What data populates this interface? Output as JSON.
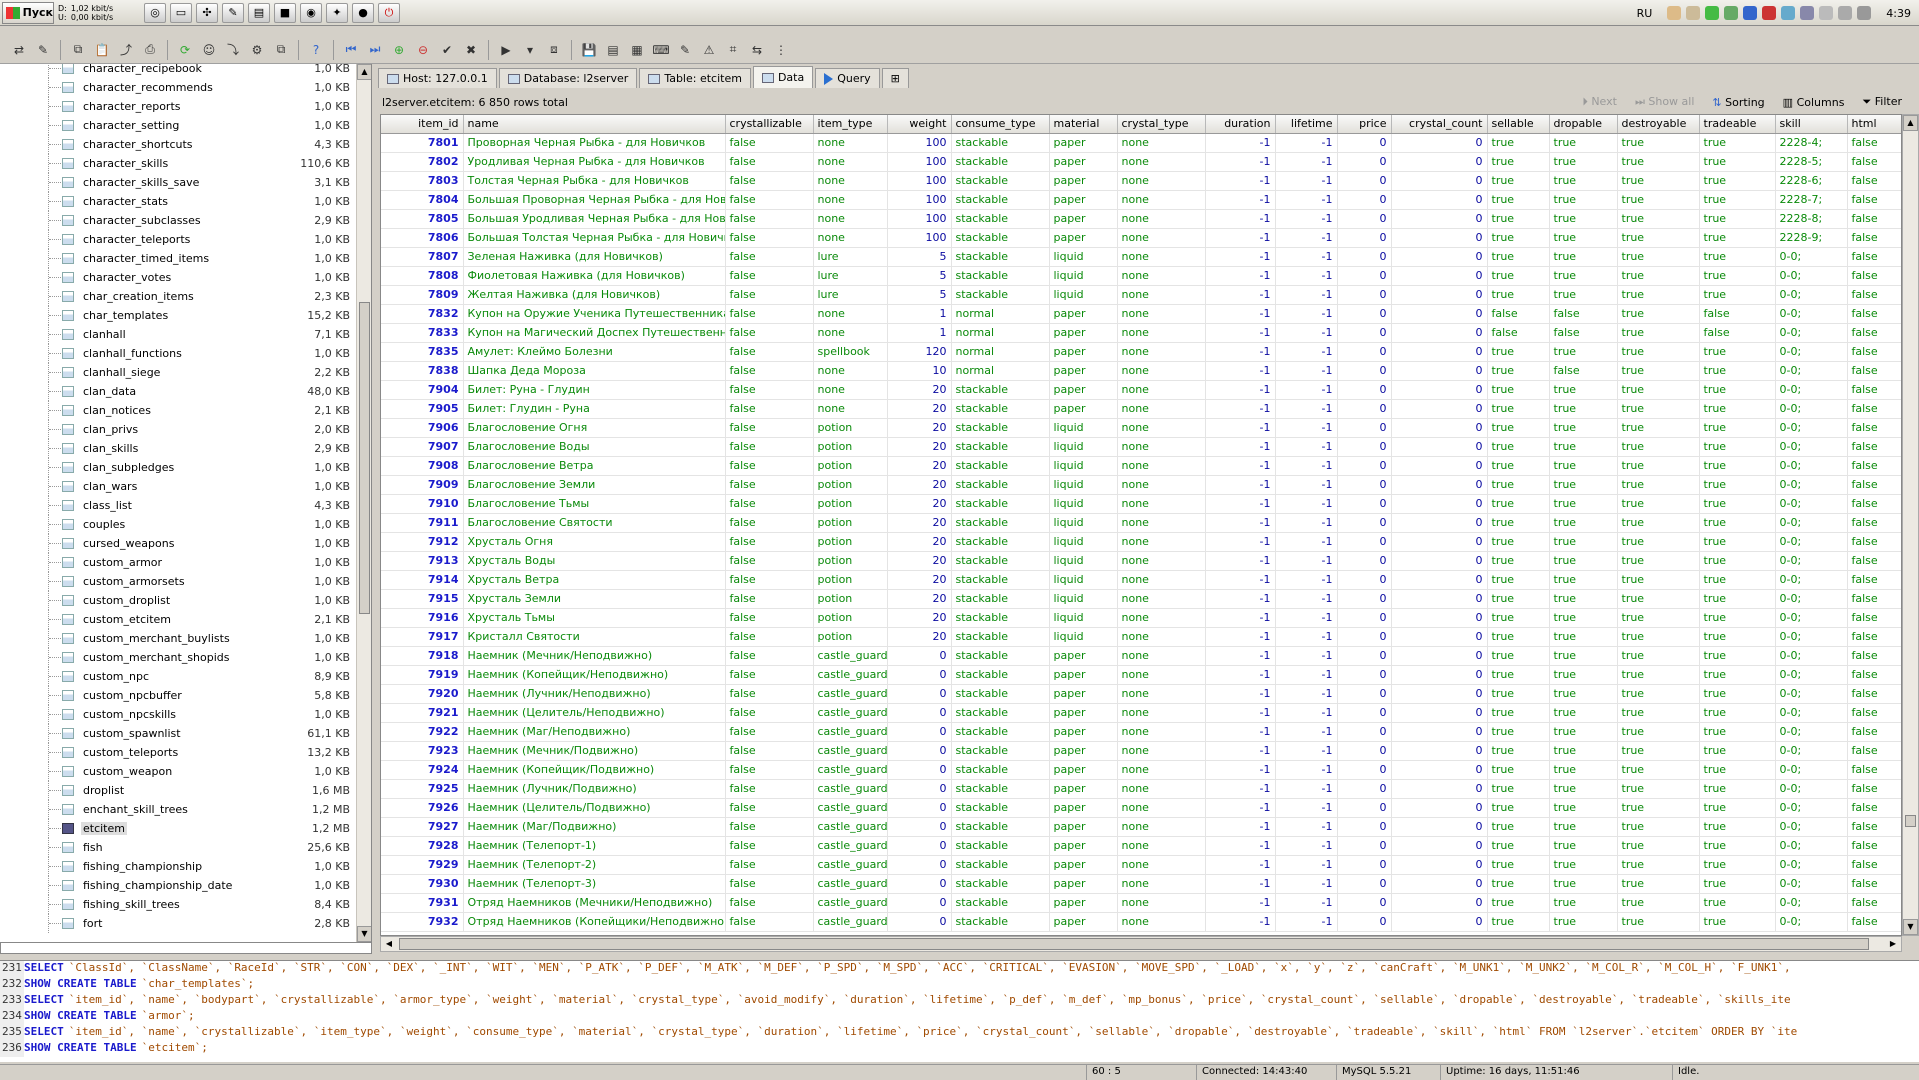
{
  "taskbar": {
    "start_label": "Пуск",
    "net_d_label": "D:",
    "net_u_label": "U:",
    "net_d_value": "1,02 kbit/s",
    "net_u_value": "0,00 kbit/s",
    "lang": "RU",
    "clock": "4:39"
  },
  "tabs": [
    {
      "label": "Host: 127.0.0.1"
    },
    {
      "label": "Database: l2server"
    },
    {
      "label": "Table: etcitem"
    },
    {
      "label": "Data"
    },
    {
      "label": "Query"
    }
  ],
  "infobar": {
    "summary": "l2server.etcitem: 6 850 rows total",
    "next": "Next",
    "show_all": "Show all",
    "sorting": "Sorting",
    "columns": "Columns",
    "filter": "Filter"
  },
  "tree": {
    "selected": "etcitem",
    "items": [
      {
        "name": "character_recipebook",
        "size": "1,0 KB"
      },
      {
        "name": "character_recommends",
        "size": "1,0 KB"
      },
      {
        "name": "character_reports",
        "size": "1,0 KB"
      },
      {
        "name": "character_setting",
        "size": "1,0 KB"
      },
      {
        "name": "character_shortcuts",
        "size": "4,3 KB"
      },
      {
        "name": "character_skills",
        "size": "110,6 KB"
      },
      {
        "name": "character_skills_save",
        "size": "3,1 KB"
      },
      {
        "name": "character_stats",
        "size": "1,0 KB"
      },
      {
        "name": "character_subclasses",
        "size": "2,9 KB"
      },
      {
        "name": "character_teleports",
        "size": "1,0 KB"
      },
      {
        "name": "character_timed_items",
        "size": "1,0 KB"
      },
      {
        "name": "character_votes",
        "size": "1,0 KB"
      },
      {
        "name": "char_creation_items",
        "size": "2,3 KB"
      },
      {
        "name": "char_templates",
        "size": "15,2 KB"
      },
      {
        "name": "clanhall",
        "size": "7,1 KB"
      },
      {
        "name": "clanhall_functions",
        "size": "1,0 KB"
      },
      {
        "name": "clanhall_siege",
        "size": "2,2 KB"
      },
      {
        "name": "clan_data",
        "size": "48,0 KB"
      },
      {
        "name": "clan_notices",
        "size": "2,1 KB"
      },
      {
        "name": "clan_privs",
        "size": "2,0 KB"
      },
      {
        "name": "clan_skills",
        "size": "2,9 KB"
      },
      {
        "name": "clan_subpledges",
        "size": "1,0 KB"
      },
      {
        "name": "clan_wars",
        "size": "1,0 KB"
      },
      {
        "name": "class_list",
        "size": "4,3 KB"
      },
      {
        "name": "couples",
        "size": "1,0 KB"
      },
      {
        "name": "cursed_weapons",
        "size": "1,0 KB"
      },
      {
        "name": "custom_armor",
        "size": "1,0 KB"
      },
      {
        "name": "custom_armorsets",
        "size": "1,0 KB"
      },
      {
        "name": "custom_droplist",
        "size": "1,0 KB"
      },
      {
        "name": "custom_etcitem",
        "size": "2,1 KB"
      },
      {
        "name": "custom_merchant_buylists",
        "size": "1,0 KB"
      },
      {
        "name": "custom_merchant_shopids",
        "size": "1,0 KB"
      },
      {
        "name": "custom_npc",
        "size": "8,9 KB"
      },
      {
        "name": "custom_npcbuffer",
        "size": "5,8 KB"
      },
      {
        "name": "custom_npcskills",
        "size": "1,0 KB"
      },
      {
        "name": "custom_spawnlist",
        "size": "61,1 KB"
      },
      {
        "name": "custom_teleports",
        "size": "13,2 KB"
      },
      {
        "name": "custom_weapon",
        "size": "1,0 KB"
      },
      {
        "name": "droplist",
        "size": "1,6 MB"
      },
      {
        "name": "enchant_skill_trees",
        "size": "1,2 MB"
      },
      {
        "name": "etcitem",
        "size": "1,2 MB"
      },
      {
        "name": "fish",
        "size": "25,6 KB"
      },
      {
        "name": "fishing_championship",
        "size": "1,0 KB"
      },
      {
        "name": "fishing_championship_date",
        "size": "1,0 KB"
      },
      {
        "name": "fishing_skill_trees",
        "size": "8,4 KB"
      },
      {
        "name": "fort",
        "size": "2,8 KB"
      }
    ]
  },
  "grid": {
    "columns": [
      "item_id",
      "name",
      "crystallizable",
      "item_type",
      "weight",
      "consume_type",
      "material",
      "crystal_type",
      "duration",
      "lifetime",
      "price",
      "crystal_count",
      "sellable",
      "dropable",
      "destroyable",
      "tradeable",
      "skill",
      "html"
    ],
    "rows": [
      [
        "7801",
        "Проворная Черная Рыбка - для Новичков",
        "false",
        "none",
        "100",
        "stackable",
        "paper",
        "none",
        "-1",
        "-1",
        "0",
        "0",
        "true",
        "true",
        "true",
        "true",
        "2228-4;",
        "false"
      ],
      [
        "7802",
        "Уродливая Черная Рыбка - для Новичков",
        "false",
        "none",
        "100",
        "stackable",
        "paper",
        "none",
        "-1",
        "-1",
        "0",
        "0",
        "true",
        "true",
        "true",
        "true",
        "2228-5;",
        "false"
      ],
      [
        "7803",
        "Толстая Черная Рыбка - для Новичков",
        "false",
        "none",
        "100",
        "stackable",
        "paper",
        "none",
        "-1",
        "-1",
        "0",
        "0",
        "true",
        "true",
        "true",
        "true",
        "2228-6;",
        "false"
      ],
      [
        "7804",
        "Большая Проворная Черная Рыбка - для Нови...",
        "false",
        "none",
        "100",
        "stackable",
        "paper",
        "none",
        "-1",
        "-1",
        "0",
        "0",
        "true",
        "true",
        "true",
        "true",
        "2228-7;",
        "false"
      ],
      [
        "7805",
        "Большая Уродливая Черная Рыбка - для Нови...",
        "false",
        "none",
        "100",
        "stackable",
        "paper",
        "none",
        "-1",
        "-1",
        "0",
        "0",
        "true",
        "true",
        "true",
        "true",
        "2228-8;",
        "false"
      ],
      [
        "7806",
        "Большая Толстая Черная Рыбка - для Новичков",
        "false",
        "none",
        "100",
        "stackable",
        "paper",
        "none",
        "-1",
        "-1",
        "0",
        "0",
        "true",
        "true",
        "true",
        "true",
        "2228-9;",
        "false"
      ],
      [
        "7807",
        "Зеленая Наживка (для Новичков)",
        "false",
        "lure",
        "5",
        "stackable",
        "liquid",
        "none",
        "-1",
        "-1",
        "0",
        "0",
        "true",
        "true",
        "true",
        "true",
        "0-0;",
        "false"
      ],
      [
        "7808",
        "Фиолетовая Наживка (для Новичков)",
        "false",
        "lure",
        "5",
        "stackable",
        "liquid",
        "none",
        "-1",
        "-1",
        "0",
        "0",
        "true",
        "true",
        "true",
        "true",
        "0-0;",
        "false"
      ],
      [
        "7809",
        "Желтая Наживка (для Новичков)",
        "false",
        "lure",
        "5",
        "stackable",
        "liquid",
        "none",
        "-1",
        "-1",
        "0",
        "0",
        "true",
        "true",
        "true",
        "true",
        "0-0;",
        "false"
      ],
      [
        "7832",
        "Купон на Оружие Ученика Путешественника",
        "false",
        "none",
        "1",
        "normal",
        "paper",
        "none",
        "-1",
        "-1",
        "0",
        "0",
        "false",
        "false",
        "true",
        "false",
        "0-0;",
        "false"
      ],
      [
        "7833",
        "Купон на Магический Доспех Путешественника",
        "false",
        "none",
        "1",
        "normal",
        "paper",
        "none",
        "-1",
        "-1",
        "0",
        "0",
        "false",
        "false",
        "true",
        "false",
        "0-0;",
        "false"
      ],
      [
        "7835",
        "Амулет: Клеймо Болезни",
        "false",
        "spellbook",
        "120",
        "normal",
        "paper",
        "none",
        "-1",
        "-1",
        "0",
        "0",
        "true",
        "true",
        "true",
        "true",
        "0-0;",
        "false"
      ],
      [
        "7838",
        "Шапка Деда Мороза",
        "false",
        "none",
        "10",
        "normal",
        "paper",
        "none",
        "-1",
        "-1",
        "0",
        "0",
        "true",
        "false",
        "true",
        "true",
        "0-0;",
        "false"
      ],
      [
        "7904",
        "Билет: Руна - Глудин",
        "false",
        "none",
        "20",
        "stackable",
        "paper",
        "none",
        "-1",
        "-1",
        "0",
        "0",
        "true",
        "true",
        "true",
        "true",
        "0-0;",
        "false"
      ],
      [
        "7905",
        "Билет: Глудин - Руна",
        "false",
        "none",
        "20",
        "stackable",
        "paper",
        "none",
        "-1",
        "-1",
        "0",
        "0",
        "true",
        "true",
        "true",
        "true",
        "0-0;",
        "false"
      ],
      [
        "7906",
        "Благословение Огня",
        "false",
        "potion",
        "20",
        "stackable",
        "liquid",
        "none",
        "-1",
        "-1",
        "0",
        "0",
        "true",
        "true",
        "true",
        "true",
        "0-0;",
        "false"
      ],
      [
        "7907",
        "Благословение Воды",
        "false",
        "potion",
        "20",
        "stackable",
        "liquid",
        "none",
        "-1",
        "-1",
        "0",
        "0",
        "true",
        "true",
        "true",
        "true",
        "0-0;",
        "false"
      ],
      [
        "7908",
        "Благословение Ветра",
        "false",
        "potion",
        "20",
        "stackable",
        "liquid",
        "none",
        "-1",
        "-1",
        "0",
        "0",
        "true",
        "true",
        "true",
        "true",
        "0-0;",
        "false"
      ],
      [
        "7909",
        "Благословение Земли",
        "false",
        "potion",
        "20",
        "stackable",
        "liquid",
        "none",
        "-1",
        "-1",
        "0",
        "0",
        "true",
        "true",
        "true",
        "true",
        "0-0;",
        "false"
      ],
      [
        "7910",
        "Благословение Тьмы",
        "false",
        "potion",
        "20",
        "stackable",
        "liquid",
        "none",
        "-1",
        "-1",
        "0",
        "0",
        "true",
        "true",
        "true",
        "true",
        "0-0;",
        "false"
      ],
      [
        "7911",
        "Благословение Святости",
        "false",
        "potion",
        "20",
        "stackable",
        "liquid",
        "none",
        "-1",
        "-1",
        "0",
        "0",
        "true",
        "true",
        "true",
        "true",
        "0-0;",
        "false"
      ],
      [
        "7912",
        "Хрусталь Огня",
        "false",
        "potion",
        "20",
        "stackable",
        "liquid",
        "none",
        "-1",
        "-1",
        "0",
        "0",
        "true",
        "true",
        "true",
        "true",
        "0-0;",
        "false"
      ],
      [
        "7913",
        "Хрусталь Воды",
        "false",
        "potion",
        "20",
        "stackable",
        "liquid",
        "none",
        "-1",
        "-1",
        "0",
        "0",
        "true",
        "true",
        "true",
        "true",
        "0-0;",
        "false"
      ],
      [
        "7914",
        "Хрусталь Ветра",
        "false",
        "potion",
        "20",
        "stackable",
        "liquid",
        "none",
        "-1",
        "-1",
        "0",
        "0",
        "true",
        "true",
        "true",
        "true",
        "0-0;",
        "false"
      ],
      [
        "7915",
        "Хрусталь Земли",
        "false",
        "potion",
        "20",
        "stackable",
        "liquid",
        "none",
        "-1",
        "-1",
        "0",
        "0",
        "true",
        "true",
        "true",
        "true",
        "0-0;",
        "false"
      ],
      [
        "7916",
        "Хрусталь Тьмы",
        "false",
        "potion",
        "20",
        "stackable",
        "liquid",
        "none",
        "-1",
        "-1",
        "0",
        "0",
        "true",
        "true",
        "true",
        "true",
        "0-0;",
        "false"
      ],
      [
        "7917",
        "Кристалл Святости",
        "false",
        "potion",
        "20",
        "stackable",
        "liquid",
        "none",
        "-1",
        "-1",
        "0",
        "0",
        "true",
        "true",
        "true",
        "true",
        "0-0;",
        "false"
      ],
      [
        "7918",
        "Наемник (Мечник/Неподвижно)",
        "false",
        "castle_guard",
        "0",
        "stackable",
        "paper",
        "none",
        "-1",
        "-1",
        "0",
        "0",
        "true",
        "true",
        "true",
        "true",
        "0-0;",
        "false"
      ],
      [
        "7919",
        "Наемник (Копейщик/Неподвижно)",
        "false",
        "castle_guard",
        "0",
        "stackable",
        "paper",
        "none",
        "-1",
        "-1",
        "0",
        "0",
        "true",
        "true",
        "true",
        "true",
        "0-0;",
        "false"
      ],
      [
        "7920",
        "Наемник (Лучник/Неподвижно)",
        "false",
        "castle_guard",
        "0",
        "stackable",
        "paper",
        "none",
        "-1",
        "-1",
        "0",
        "0",
        "true",
        "true",
        "true",
        "true",
        "0-0;",
        "false"
      ],
      [
        "7921",
        "Наемник (Целитель/Неподвижно)",
        "false",
        "castle_guard",
        "0",
        "stackable",
        "paper",
        "none",
        "-1",
        "-1",
        "0",
        "0",
        "true",
        "true",
        "true",
        "true",
        "0-0;",
        "false"
      ],
      [
        "7922",
        "Наемник (Маг/Неподвижно)",
        "false",
        "castle_guard",
        "0",
        "stackable",
        "paper",
        "none",
        "-1",
        "-1",
        "0",
        "0",
        "true",
        "true",
        "true",
        "true",
        "0-0;",
        "false"
      ],
      [
        "7923",
        "Наемник (Мечник/Подвижно)",
        "false",
        "castle_guard",
        "0",
        "stackable",
        "paper",
        "none",
        "-1",
        "-1",
        "0",
        "0",
        "true",
        "true",
        "true",
        "true",
        "0-0;",
        "false"
      ],
      [
        "7924",
        "Наемник (Копейщик/Подвижно)",
        "false",
        "castle_guard",
        "0",
        "stackable",
        "paper",
        "none",
        "-1",
        "-1",
        "0",
        "0",
        "true",
        "true",
        "true",
        "true",
        "0-0;",
        "false"
      ],
      [
        "7925",
        "Наемник (Лучник/Подвижно)",
        "false",
        "castle_guard",
        "0",
        "stackable",
        "paper",
        "none",
        "-1",
        "-1",
        "0",
        "0",
        "true",
        "true",
        "true",
        "true",
        "0-0;",
        "false"
      ],
      [
        "7926",
        "Наемник (Целитель/Подвижно)",
        "false",
        "castle_guard",
        "0",
        "stackable",
        "paper",
        "none",
        "-1",
        "-1",
        "0",
        "0",
        "true",
        "true",
        "true",
        "true",
        "0-0;",
        "false"
      ],
      [
        "7927",
        "Наемник (Маг/Подвижно)",
        "false",
        "castle_guard",
        "0",
        "stackable",
        "paper",
        "none",
        "-1",
        "-1",
        "0",
        "0",
        "true",
        "true",
        "true",
        "true",
        "0-0;",
        "false"
      ],
      [
        "7928",
        "Наемник (Телепорт-1)",
        "false",
        "castle_guard",
        "0",
        "stackable",
        "paper",
        "none",
        "-1",
        "-1",
        "0",
        "0",
        "true",
        "true",
        "true",
        "true",
        "0-0;",
        "false"
      ],
      [
        "7929",
        "Наемник (Телепорт-2)",
        "false",
        "castle_guard",
        "0",
        "stackable",
        "paper",
        "none",
        "-1",
        "-1",
        "0",
        "0",
        "true",
        "true",
        "true",
        "true",
        "0-0;",
        "false"
      ],
      [
        "7930",
        "Наемник (Телепорт-3)",
        "false",
        "castle_guard",
        "0",
        "stackable",
        "paper",
        "none",
        "-1",
        "-1",
        "0",
        "0",
        "true",
        "true",
        "true",
        "true",
        "0-0;",
        "false"
      ],
      [
        "7931",
        "Отряд Наемников (Мечники/Неподвижно)",
        "false",
        "castle_guard",
        "0",
        "stackable",
        "paper",
        "none",
        "-1",
        "-1",
        "0",
        "0",
        "true",
        "true",
        "true",
        "true",
        "0-0;",
        "false"
      ],
      [
        "7932",
        "Отряд Наемников (Копейщики/Неподвижно)",
        "false",
        "castle_guard",
        "0",
        "stackable",
        "paper",
        "none",
        "-1",
        "-1",
        "0",
        "0",
        "true",
        "true",
        "true",
        "true",
        "0-0;",
        "false"
      ]
    ]
  },
  "sql": [
    {
      "ln": "231",
      "kw": "SELECT",
      "rest": "`ClassId`, `ClassName`, `RaceId`, `STR`, `CON`, `DEX`, `_INT`, `WIT`, `MEN`, `P_ATK`, `P_DEF`, `M_ATK`, `M_DEF`, `P_SPD`, `M_SPD`, `ACC`, `CRITICAL`, `EVASION`, `MOVE_SPD`, `_LOAD`, `x`, `y`, `z`, `canCraft`, `M_UNK1`, `M_UNK2`, `M_COL_R`, `M_COL_H`, `F_UNK1`,"
    },
    {
      "ln": "232",
      "kw": "SHOW CREATE TABLE",
      "rest": "`char_templates`;"
    },
    {
      "ln": "233",
      "kw": "SELECT",
      "rest": "`item_id`, `name`, `bodypart`, `crystallizable`, `armor_type`, `weight`, `material`, `crystal_type`, `avoid_modify`, `duration`, `lifetime`, `p_def`, `m_def`, `mp_bonus`, `price`, `crystal_count`, `sellable`, `dropable`, `destroyable`, `tradeable`, `skills_ite"
    },
    {
      "ln": "234",
      "kw": "SHOW CREATE TABLE",
      "rest": "`armor`;"
    },
    {
      "ln": "235",
      "kw": "SELECT",
      "rest": "`item_id`, `name`, `crystallizable`, `item_type`, `weight`, `consume_type`, `material`, `crystal_type`, `duration`, `lifetime`, `price`, `crystal_count`, `sellable`, `dropable`, `destroyable`, `tradeable`, `skill`, `html` FROM `l2server`.`etcitem` ORDER BY `ite"
    },
    {
      "ln": "236",
      "kw": "SHOW CREATE TABLE",
      "rest": "`etcitem`;"
    }
  ],
  "status": {
    "position": "60 : 5",
    "connected": "Connected: 14:43:40",
    "server": "MySQL 5.5.21",
    "uptime": "Uptime: 16 days, 11:51:46",
    "state": "Idle."
  }
}
